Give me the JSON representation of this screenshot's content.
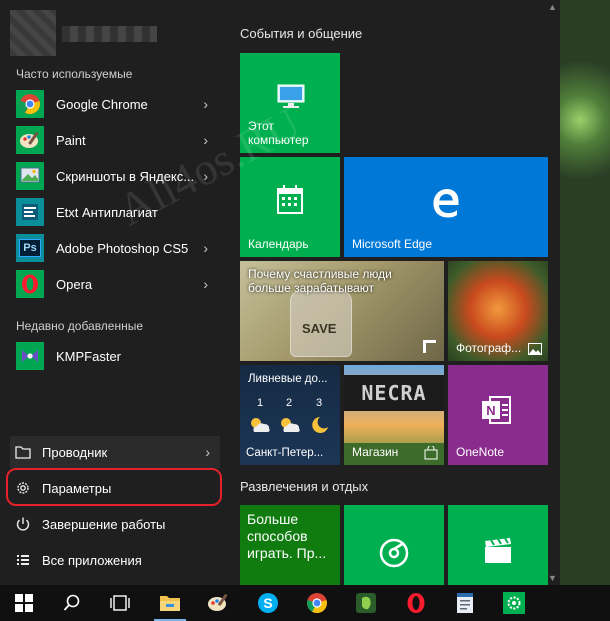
{
  "colors": {
    "tile_green": "#00b050",
    "tile_blue": "#0078d7",
    "tile_purple": "#8a2c8e",
    "highlight": "#e3222b"
  },
  "left": {
    "frequent_label": "Часто используемые",
    "apps": [
      {
        "label": "Google Chrome",
        "icon": "chrome-icon"
      },
      {
        "label": "Paint",
        "icon": "paint-icon"
      },
      {
        "label": "Скриншоты в Яндекс...",
        "icon": "screenshot-icon"
      },
      {
        "label": "Etxt Антиплагиат",
        "icon": "etxt-icon"
      },
      {
        "label": "Adobe Photoshop CS5",
        "icon": "photoshop-icon",
        "icon_text": "Ps"
      },
      {
        "label": "Opera",
        "icon": "opera-icon"
      }
    ],
    "recent_label": "Недавно добавленные",
    "recent_apps": [
      {
        "label": "KMPFaster",
        "icon": "kmp-icon"
      }
    ],
    "system": [
      {
        "label": "Проводник",
        "icon": "folder-icon"
      },
      {
        "label": "Параметры",
        "icon": "gear-icon"
      },
      {
        "label": "Завершение работы",
        "icon": "power-icon"
      },
      {
        "label": "Все приложения",
        "icon": "all-apps-icon"
      }
    ]
  },
  "groups": {
    "social_title": "События и общение",
    "games_title": "Развлечения и отдых"
  },
  "tiles": {
    "computer": "Этот компьютер",
    "calendar": "Календарь",
    "edge": "Microsoft Edge",
    "news": "Почему счастливые люди больше зарабатывают",
    "news_jar_text": "SAVE",
    "photos": "Фотограф...",
    "weather": {
      "title": "Ливневые до...",
      "days": [
        "1",
        "2",
        "3"
      ],
      "city": "Санкт-Петер..."
    },
    "store": "Магазин",
    "minecraft_text": "NECRA",
    "onenote": "OneNote",
    "xbox": "Больше способов играть. Пр...",
    "groove": "",
    "films": ""
  },
  "watermark": "All4os.RU"
}
